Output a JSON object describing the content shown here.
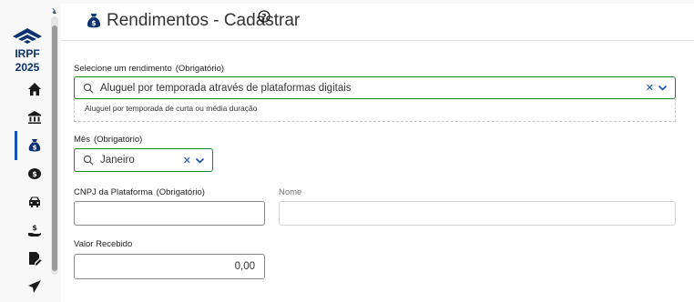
{
  "sidebar": {
    "logo_icon": "receita-federal-logo-icon",
    "irpf_label": "IRPF",
    "year_label": "2025",
    "items": [
      {
        "icon": "home-icon",
        "active": false
      },
      {
        "icon": "bank-icon",
        "active": false
      },
      {
        "icon": "money-bag-icon",
        "active": true
      },
      {
        "icon": "coin-icon",
        "active": false
      },
      {
        "icon": "car-icon",
        "active": false
      },
      {
        "icon": "hand-money-icon",
        "active": false
      },
      {
        "icon": "file-edit-icon",
        "active": false
      },
      {
        "icon": "send-icon",
        "active": false
      }
    ],
    "accent": "#1351b4"
  },
  "page": {
    "title": "Rendimentos - Cadastrar",
    "help_icon": "help-circle-icon"
  },
  "form": {
    "rendimento": {
      "label": "Selecione um rendimento",
      "required": "(Obrigatório)",
      "value": "Aluguel por temporada através de plataformas digitais",
      "description": "Aluguel por temporada de curta ou média duração"
    },
    "mes": {
      "label": "Mês",
      "required": "(Obrigatório)",
      "value": "Janeiro"
    },
    "cnpj": {
      "label": "CNPJ da Plataforma",
      "required": "(Obrigatório)",
      "value": ""
    },
    "nome": {
      "label": "Nome",
      "value": ""
    },
    "valor": {
      "label": "Valor Recebido",
      "value": "0,00"
    }
  },
  "colors": {
    "valid_border": "#168821",
    "brand_blue": "#1351b4"
  }
}
